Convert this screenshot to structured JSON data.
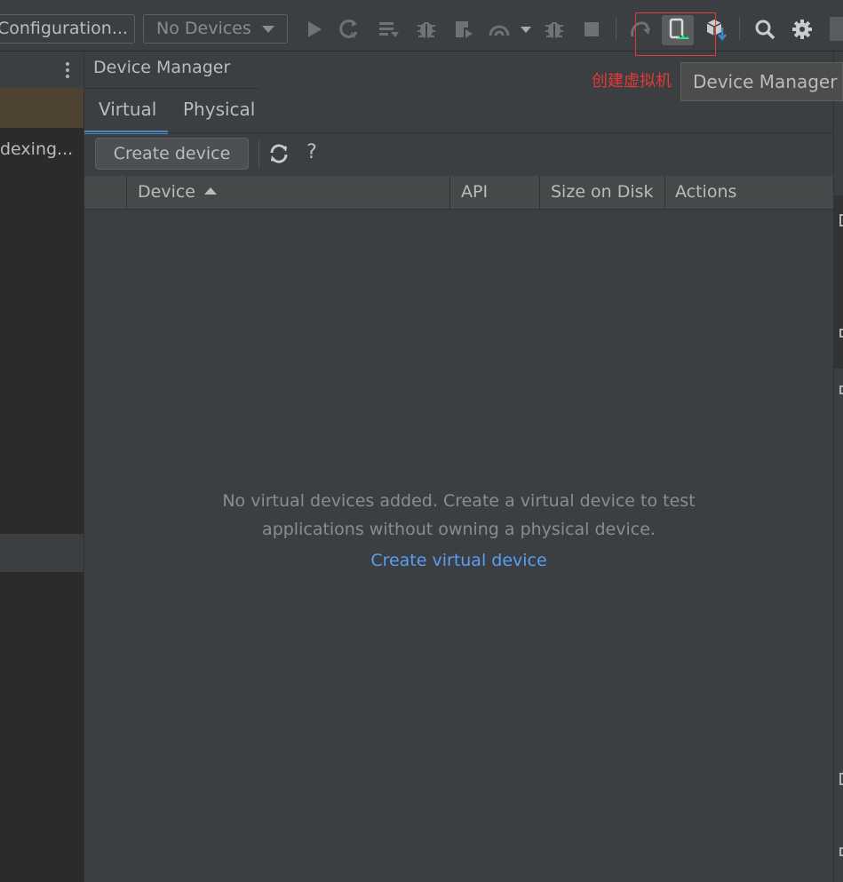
{
  "toolbar": {
    "run_config": "Configuration...",
    "device_selector": "No Devices",
    "icons": [
      "run-icon",
      "apply-changes-icon",
      "apply-code-changes-icon",
      "debug-icon",
      "profile-icon",
      "attach-debugger-icon",
      "more-dropdown-icon",
      "stop-icon",
      "sync-gradle-icon",
      "device-manager-icon",
      "sdk-manager-icon",
      "search-icon",
      "settings-icon"
    ]
  },
  "project_panel": {
    "status_text": "dexing..."
  },
  "device_manager": {
    "title": "Device Manager",
    "tabs": [
      {
        "label": "Virtual",
        "active": true
      },
      {
        "label": "Physical",
        "active": false
      }
    ],
    "create_button": "Create device",
    "help_label": "?",
    "columns": [
      "Device",
      "API",
      "Size on Disk",
      "Actions"
    ],
    "sort_column": "Device",
    "empty_line1": "No virtual devices added. Create a virtual device to test",
    "empty_line2": "applications without owning a physical device.",
    "create_link": "Create virtual device"
  },
  "annotation": "创建虚拟机",
  "tooltip": "Device Manager",
  "colors": {
    "background": "#3c3f41",
    "panel_dark": "#2b2b2b",
    "accent_tab": "#4a88c7",
    "link": "#589df6",
    "annotation_red": "#e53935",
    "android_green": "#3ddc84"
  }
}
